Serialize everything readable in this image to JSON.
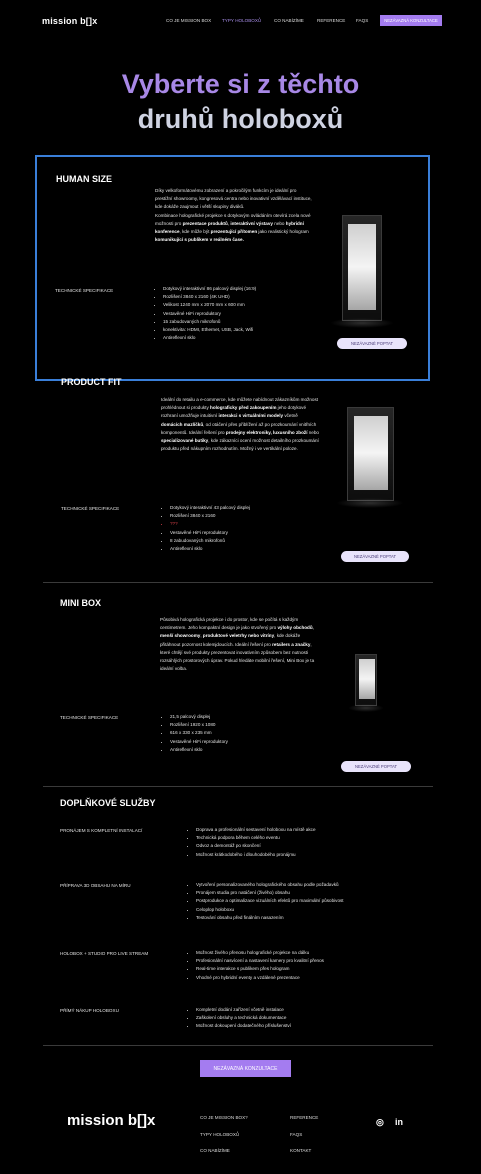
{
  "header": {
    "logo": "mission b[]x",
    "nav": [
      "CO JE MISSION BOX",
      "TYPY HOLOBOXŮ",
      "CO NABÍZÍME",
      "REFERENCE",
      "FAQS"
    ],
    "active_index": 1,
    "cta": "NEZÁVAZNÁ KONZULTACE"
  },
  "hero": {
    "line1": "Vyberte si z těchto",
    "line2": "druhů holoboxů"
  },
  "products": [
    {
      "title": "HUMAN SIZE",
      "desc_html": "Díky velkoformátovému zobrazení a pokročilým funkcím je ideální pro prestižní showroomy, kongresová centra nebo inovativní vzdělávací instituce, kde dokáže zaujmout i větší skupiny diváků.<br>Kombinace holografické projekce s dotykovým ovládáním otevírá zcela nové možnosti pro <b>prezentace produktů</b>, <b>interaktivní výstavy</b> nebo <b>hybridní konference</b>, kde může být <b>prezentující přítomen</b> jako realistický hologram <b>komunikující s publikem v reálném čase.</b>",
      "spec_label": "TECHNICKÉ SPECIFIKACE",
      "specs": [
        "Dotykový interaktivní 86 palcový displej (16:9)",
        "Rozlišení 3840 x 2160 (4K UHD)",
        "Velikost 1240 mm x 2070 mm x 600 mm",
        "Vestavěné HiFi reproduktory",
        "15 zabudovaných mikrofonů",
        "konektivita: HDMI, Ethernet, USB, Jack, Wifi",
        "Antireflexní sklo"
      ],
      "button": "NEZÁVAZNÉ POPTAT"
    },
    {
      "title": "PRODUCT FIT",
      "desc_html": "Ideální do retailu a e-commerce, kde můžete nabídnout zákazníkům možnost prohlédnout si produkty <b>holograficky před zakoupením</b> jeho dotykové rozhraní umožňuje intuitivní <b>interakci s virtuálními modely</b> včetně <b>domácích mazlíčků</b>, od otáčení přes přiblížení až po prozkoumání vnitřních komponentů. Ideální řešení pro <b>prodejny elektroniky, luxusního zboží</b> nebo <b>specializované butiky</b>, kde zákazníci ocení možnost detailního prozkoumání produktu před nákupním rozhodnutím. Možný i ve vertikální poloze.",
      "spec_label": "TECHNICKÉ SPECIFIKACE",
      "specs": [
        "Dotykový interaktivní 43 palcový displej",
        "Rozlišení 3840 x 2160",
        "???",
        "Vestavěné HiFi reproduktory",
        "8 zabudovaných mikrofonů",
        "Antireflexní sklo"
      ],
      "red_index": 2,
      "button": "NEZÁVAZNÉ POPTAT"
    },
    {
      "title": "MINI BOX",
      "desc_html": "Působivá holografická projekce i do prostor, kde se počítá s každým centimetrem. Jeho kompaktní design je jako stvořený pro <b>výlohy obchodů</b>, <b>menší showroomy</b>, <b>produktové veletrhy nebo vitríny</b>, kde dokáže přitáhnout pozornost kolemjdoucích. Ideální řešení pro <b>retailers a značky</b>, které chtějí své produkty prezentovat inovativním způsobem bez nutnosti rozsáhlých prostorových úprav. Pokud hledáte mobilní řešení, Mini Box je ta ideální volba.",
      "spec_label": "TECHNICKÉ SPECIFIKACE",
      "specs": [
        "21,5 palcový displej",
        "Rozlišení 1920 x 1080",
        "616 x 330 x 235 mm",
        "Vestavěné HiFi reproduktory",
        "Antireflexní sklo"
      ],
      "button": "NEZÁVAZNÉ POPTAT"
    }
  ],
  "services": {
    "title": "DOPLŇKOVÉ SLUŽBY",
    "items": [
      {
        "label": "PRONÁJEM S KOMPLETNÍ INSTALACÍ",
        "points": [
          "Doprava a profesionální sestavení holoboxu na místě akce",
          "Technická podpora během celého eventu",
          "Odvoz a demontáž po skončení",
          "Možnost krátkodobého i dlouhodobého pronájmu"
        ]
      },
      {
        "label": "PŘÍPRAVA 3D OBSAHU NA MÍRU",
        "points": [
          "Vytvoření personalizovaného holografického obsahu podle požadavků",
          "Pronájem studia pro natáčení (živého) obsahu",
          "Postprodukce a optimalizace vizuálních efektů pro maximální působivost",
          "Celoplop holoboxu",
          "Testování obsahu před finálním nasazením"
        ]
      },
      {
        "label": "HOLOBOX + STUDIO PRO LIVE STREAM",
        "points": [
          "Možnost živého přenosu holografické projekce na dálku",
          "Profesionální nasvícení a nastavení kamery pro kvalitní přenos",
          "Real-time interakce s publikem přes hologram",
          "Vhodné pro hybridní eventy a vzdálené prezentace"
        ]
      },
      {
        "label": "PŘÍMÝ NÁKUP HOLOBOXU",
        "points": [
          "Kompletní dodání zařízení včetně instalace",
          "Zaškolení obsluhy a technická dokumentace",
          "Možnost dokoupení dodatečného příslušenství"
        ]
      }
    ]
  },
  "cta_bottom": "NEZÁVAZNÁ KONZULTACE",
  "footer": {
    "logo": "mission b[]x",
    "col1": [
      "CO JE MISSION BOX?",
      "TYPY HOLOBOXŮ",
      "CO NABÍZÍME"
    ],
    "col2": [
      "REFERENCE",
      "FAQS",
      "KONTAKT"
    ],
    "instagram": "◎",
    "linkedin": "in"
  }
}
